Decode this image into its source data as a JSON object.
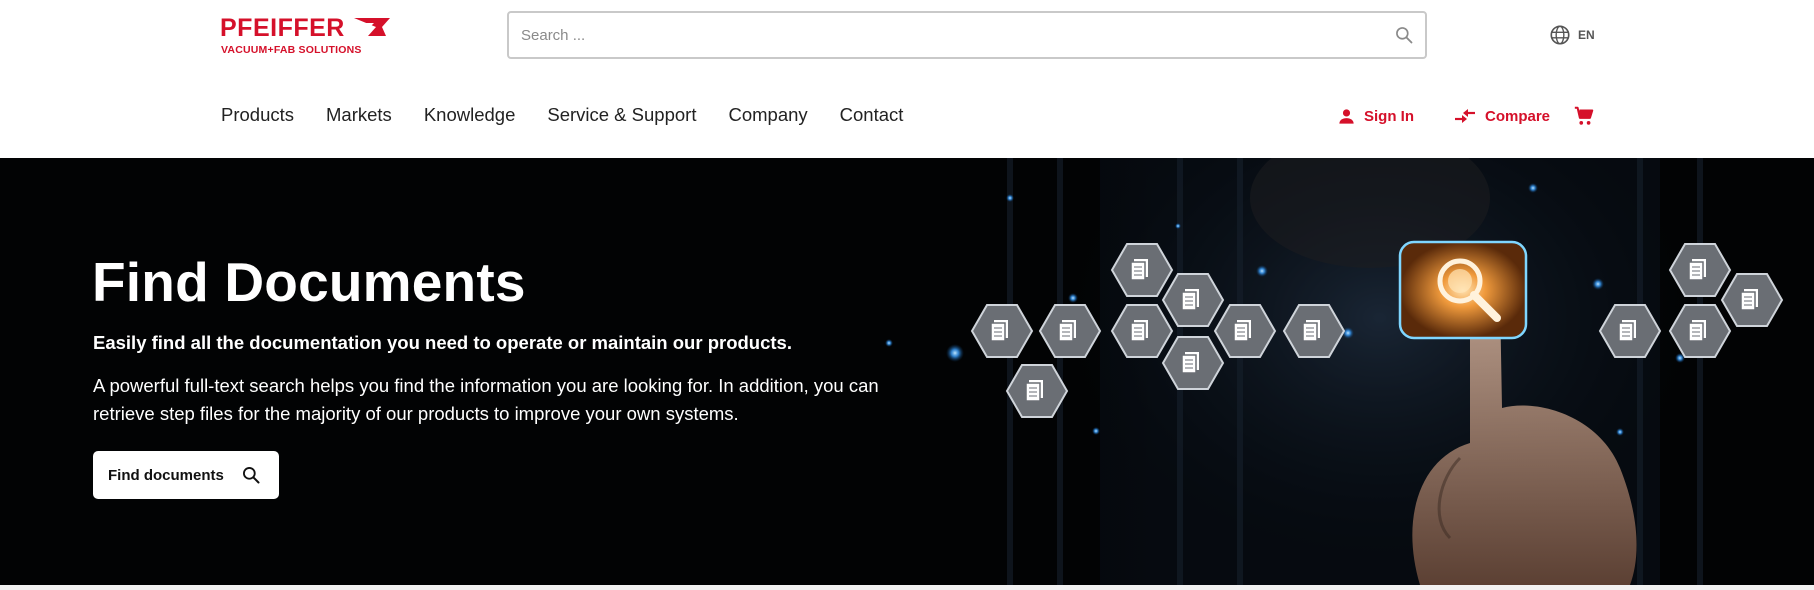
{
  "header": {
    "logo": {
      "name": "PFEIFFER",
      "subline": "VACUUM+FAB SOLUTIONS"
    },
    "search": {
      "placeholder": "Search ...",
      "icon": "search-icon"
    },
    "language": {
      "icon": "globe-icon",
      "label": "EN"
    },
    "nav": [
      {
        "label": "Products"
      },
      {
        "label": "Markets"
      },
      {
        "label": "Knowledge"
      },
      {
        "label": "Service & Support"
      },
      {
        "label": "Company"
      },
      {
        "label": "Contact"
      }
    ],
    "actions": {
      "sign_in": {
        "label": "Sign In",
        "icon": "user-icon"
      },
      "compare": {
        "label": "Compare",
        "icon": "compare-arrows-icon"
      },
      "cart": {
        "icon": "cart-icon"
      }
    }
  },
  "hero": {
    "title": "Find Documents",
    "subtitle": "Easily find all the documentation you need to operate or maintain our products.",
    "text": "A powerful full-text search helps you find the information you are looking for. In addition, you can retrieve step files for the majority of our products to improve your own systems.",
    "button": {
      "label": "Find documents",
      "icon": "search-icon"
    }
  },
  "colors": {
    "brand_red": "#d5102a",
    "hero_background": "#020304",
    "text_dark": "#222222"
  }
}
